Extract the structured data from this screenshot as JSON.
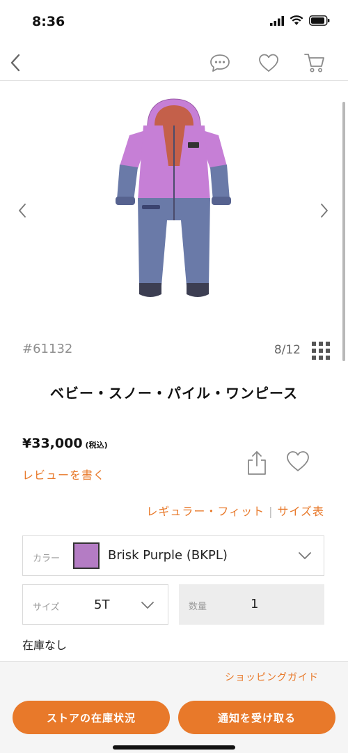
{
  "status_bar": {
    "time": "8:36"
  },
  "product": {
    "style_number": "#61132",
    "image_counter": "8/12",
    "title": "ベビー・スノー・パイル・ワンピース",
    "price": "¥33,000",
    "price_tax_note": "(税込)",
    "review_link": "レビューを書く",
    "fit_label": "レギュラー・フィット",
    "fit_separator": "|",
    "size_chart_label": "サイズ表"
  },
  "options": {
    "color_label": "カラー",
    "color_value": "Brisk Purple (BKPL)",
    "color_swatch": "#b47cc4",
    "size_label": "サイズ",
    "size_value": "5T",
    "qty_label": "数量",
    "qty_value": "1"
  },
  "stock_status": "在庫なし",
  "footer": {
    "shopping_guide": "ショッピングガイド",
    "store_stock_button": "ストアの在庫状況",
    "notify_button": "通知を受け取る"
  },
  "colors": {
    "accent": "#e8792a",
    "product_purple": "#c67fd6",
    "product_blue": "#6a7aa8"
  },
  "icons": [
    "back-icon",
    "chat-icon",
    "heart-icon",
    "cart-icon",
    "chevron-left-icon",
    "chevron-right-icon",
    "grid-icon",
    "share-icon",
    "chevron-down-icon"
  ]
}
